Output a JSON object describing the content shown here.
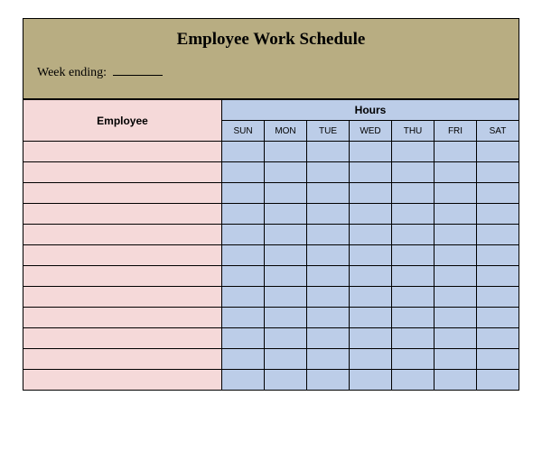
{
  "title": "Employee Work Schedule",
  "week_ending_label": "Week ending:",
  "week_ending_value": "",
  "headers": {
    "employee": "Employee",
    "hours": "Hours",
    "days": [
      "SUN",
      "MON",
      "TUE",
      "WED",
      "THU",
      "FRI",
      "SAT"
    ]
  },
  "rows": [
    {
      "employee": "",
      "hours": [
        "",
        "",
        "",
        "",
        "",
        "",
        ""
      ]
    },
    {
      "employee": "",
      "hours": [
        "",
        "",
        "",
        "",
        "",
        "",
        ""
      ]
    },
    {
      "employee": "",
      "hours": [
        "",
        "",
        "",
        "",
        "",
        "",
        ""
      ]
    },
    {
      "employee": "",
      "hours": [
        "",
        "",
        "",
        "",
        "",
        "",
        ""
      ]
    },
    {
      "employee": "",
      "hours": [
        "",
        "",
        "",
        "",
        "",
        "",
        ""
      ]
    },
    {
      "employee": "",
      "hours": [
        "",
        "",
        "",
        "",
        "",
        "",
        ""
      ]
    },
    {
      "employee": "",
      "hours": [
        "",
        "",
        "",
        "",
        "",
        "",
        ""
      ]
    },
    {
      "employee": "",
      "hours": [
        "",
        "",
        "",
        "",
        "",
        "",
        ""
      ]
    },
    {
      "employee": "",
      "hours": [
        "",
        "",
        "",
        "",
        "",
        "",
        ""
      ]
    },
    {
      "employee": "",
      "hours": [
        "",
        "",
        "",
        "",
        "",
        "",
        ""
      ]
    },
    {
      "employee": "",
      "hours": [
        "",
        "",
        "",
        "",
        "",
        "",
        ""
      ]
    },
    {
      "employee": "",
      "hours": [
        "",
        "",
        "",
        "",
        "",
        "",
        ""
      ]
    }
  ]
}
